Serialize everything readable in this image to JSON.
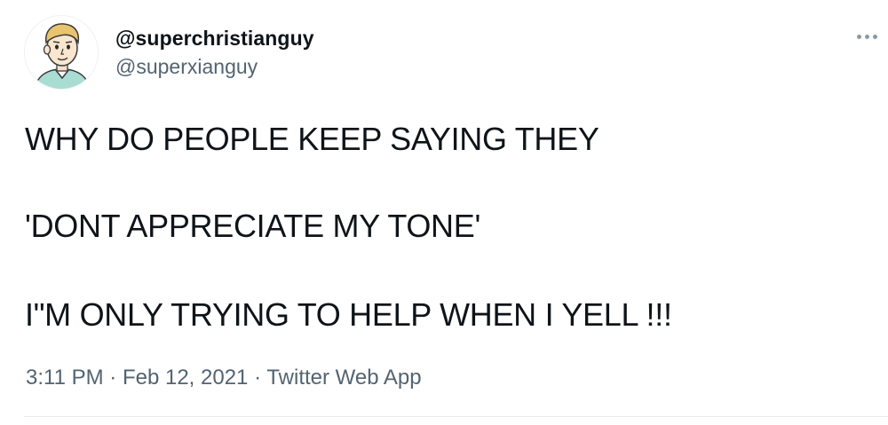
{
  "author": {
    "display_name": "@superchristianguy",
    "handle": "@superxianguy",
    "avatar_icon": "cartoon-man-avatar-icon"
  },
  "tweet": {
    "lines": [
      "WHY DO PEOPLE KEEP SAYING THEY",
      "'DONT APPRECIATE MY TONE'",
      "I\"M ONLY TRYING TO HELP WHEN I YELL !!!"
    ]
  },
  "meta": {
    "time": "3:11 PM",
    "separator": "·",
    "date": "Feb 12, 2021",
    "source": "Twitter Web App"
  },
  "actions": {
    "more_icon": "more-options-icon"
  },
  "colors": {
    "text_primary": "#0f1419",
    "text_secondary": "#536471",
    "divider": "#e7ebee"
  }
}
